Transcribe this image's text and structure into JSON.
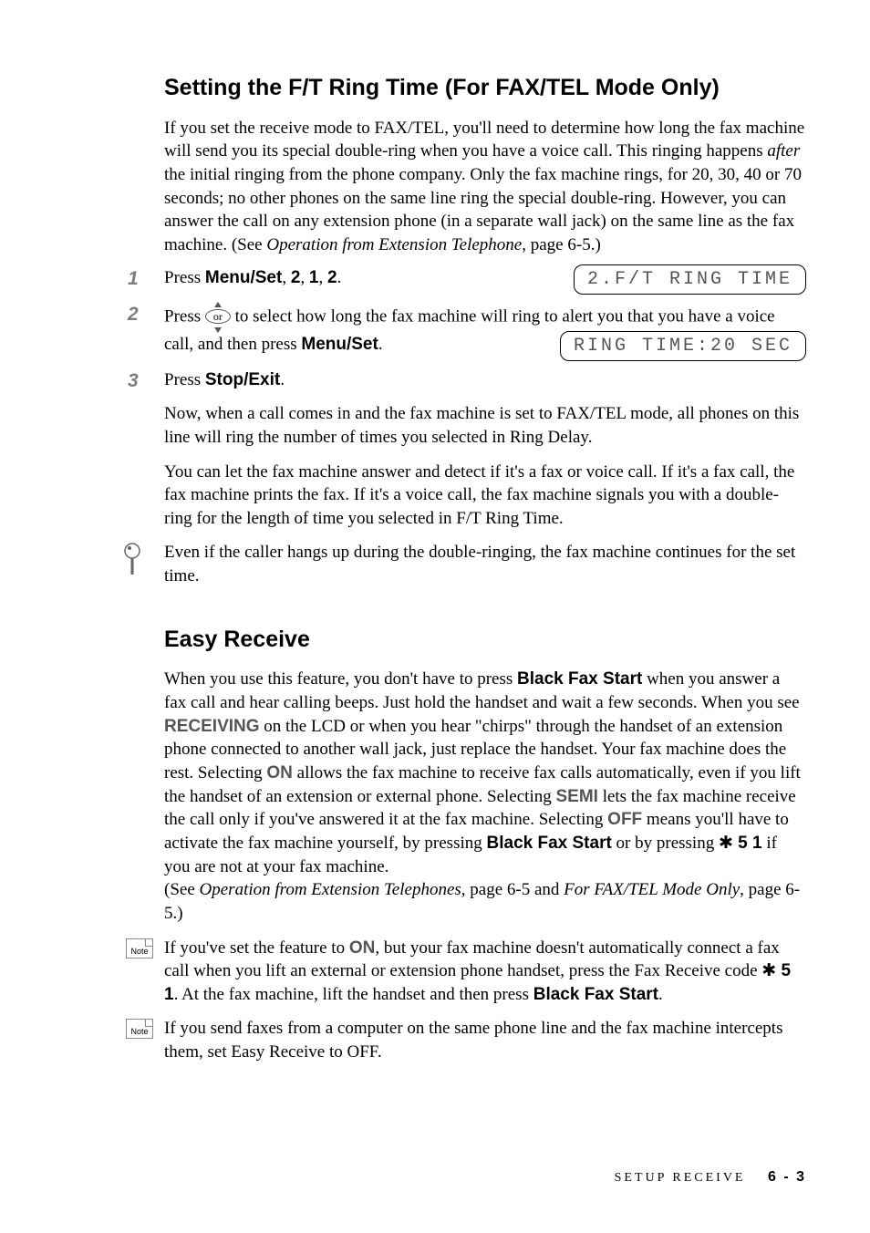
{
  "section1": {
    "title": "Setting the F/T Ring Time (For FAX/TEL Mode Only)",
    "intro_a": "If you set the receive mode to FAX/TEL, you'll need to determine how long the fax machine will send you its special double-ring when you have a voice call. This ringing happens ",
    "intro_after": "after",
    "intro_b": " the initial ringing from the phone company.  Only the fax machine rings, for 20, 30, 40 or 70 seconds; no other phones on the same line ring the special double-ring. However, you can answer the call on any extension phone (in a separate wall jack) on the same line as the fax machine. (See ",
    "intro_ref": "Operation from Extension Telephone",
    "intro_c": ", page 6-5.)",
    "step1_a": "Press ",
    "step1_keys": "Menu/Set",
    "step1_b": ", ",
    "step1_k2": "2",
    "step1_k3": "1",
    "step1_k4": "2",
    "step1_dot": ".",
    "lcd1": "2.F/T RING TIME",
    "step2_a": "Press ",
    "step2_b": " to select how long the fax machine will ring to alert you that you have a voice call, and then press ",
    "step2_key": "Menu/Set",
    "step2_dot": ".",
    "lcd2": "RING TIME:20 SEC",
    "step3_a": "Press ",
    "step3_key": "Stop/Exit",
    "step3_dot": ".",
    "para2": "Now, when a call comes in and the fax machine is set to FAX/TEL mode, all phones on this line will ring the number of times you selected in Ring Delay.",
    "para3": "You can let the fax machine answer and detect if it's a fax or voice call. If it's a fax call, the fax machine prints the fax. If it's a voice call, the fax machine signals you with a double-ring for the length of time you selected in F/T Ring Time.",
    "tip": "Even if the caller hangs up during the double-ringing, the fax machine continues for the set time."
  },
  "section2": {
    "title": "Easy Receive",
    "p1_a": "When you use this feature, you don't have to press ",
    "p1_bfs": "Black Fax Start",
    "p1_b": " when you answer a fax call and hear calling beeps. Just hold the handset and wait a few seconds. When you see ",
    "p1_recv": "RECEIVING",
    "p1_c": " on the LCD or when you hear \"chirps\" through the handset of an extension phone connected to another wall jack, just replace the handset. Your fax machine does the rest. Selecting ",
    "p1_on": "ON",
    "p1_d": " allows the fax machine to receive fax calls automatically, even if you lift the handset of an extension or external phone. Selecting ",
    "p1_semi": "SEMI",
    "p1_e": " lets the fax machine receive the call only if you've answered it at the fax machine. Selecting ",
    "p1_off": "OFF",
    "p1_f": " means you'll have to activate the fax machine yourself, by pressing ",
    "p1_bfs2": "Black Fax Start",
    "p1_g": " or by pressing ",
    "p1_code": " 5 1",
    "p1_h": " if you are not at your fax machine.",
    "p1_see_a": "(See ",
    "p1_see_ref1": "Operation from Extension Telephones",
    "p1_see_b": ", page 6-5 and ",
    "p1_see_ref2": "For FAX/TEL Mode Only",
    "p1_see_c": ", page 6-5.)",
    "note1_a": "If you've set the feature to ",
    "note1_on": "ON",
    "note1_b": ", but your fax machine doesn't automatically connect a fax call when you lift an external or extension phone handset, press the Fax Receive code ",
    "note1_code": " 5 1",
    "note1_c": ".  At the fax machine, lift the handset and then press ",
    "note1_bfs": "Black Fax Start",
    "note1_d": ".",
    "note2": "If you send faxes from a computer on the same phone line and the fax machine intercepts them, set Easy Receive to OFF."
  },
  "footer": {
    "section": "SETUP RECEIVE",
    "page": "6 - 3"
  },
  "icons": {
    "or": "or",
    "note": "Note"
  }
}
